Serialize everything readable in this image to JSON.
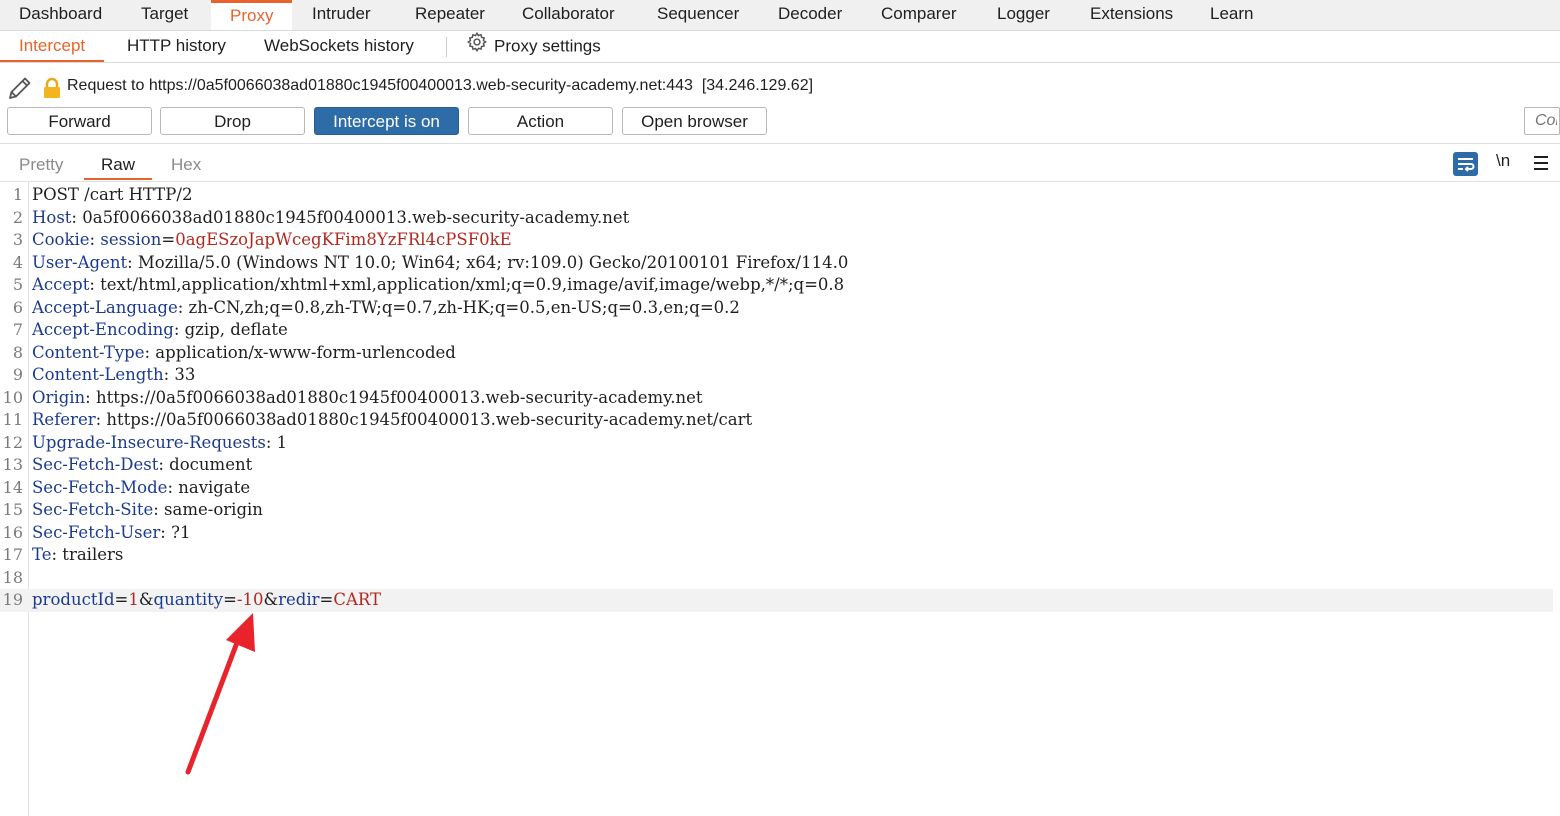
{
  "top_tabs": [
    "Dashboard",
    "Target",
    "Proxy",
    "Intruder",
    "Repeater",
    "Collaborator",
    "Sequencer",
    "Decoder",
    "Comparer",
    "Logger",
    "Extensions",
    "Learn"
  ],
  "active_top_tab": "Proxy",
  "sub_tabs": {
    "intercept": "Intercept",
    "http_history": "HTTP history",
    "websockets_history": "WebSockets history",
    "proxy_settings": "Proxy settings"
  },
  "request": {
    "label": "Request to https://0a5f0066038ad01880c1945f00400013.web-security-academy.net:443",
    "ip": "[34.246.129.62]"
  },
  "buttons": {
    "forward": "Forward",
    "drop": "Drop",
    "intercept": "Intercept is on",
    "action": "Action",
    "open_browser": "Open browser"
  },
  "comment_placeholder": "Comment this item",
  "view_tabs": {
    "pretty": "Pretty",
    "raw": "Raw",
    "hex": "Hex"
  },
  "newline_toggle": "\\n",
  "colors": {
    "accent": "#e8632b",
    "primary_button": "#2d6ca6",
    "header_name": "#1c3b8f",
    "value_red": "#b1281e",
    "arrow": "#e8232b"
  },
  "icons": [
    "pencil-icon",
    "lock-icon",
    "gear-icon",
    "wrap-lines-icon",
    "menu-icon"
  ],
  "raw_lines": {
    "l1": {
      "num": "1",
      "text": "POST /cart HTTP/2"
    },
    "l2": {
      "num": "2",
      "name": "Host",
      "value": " 0a5f0066038ad01880c1945f00400013.web-security-academy.net"
    },
    "l3": {
      "num": "3",
      "name": "Cookie",
      "sep": ": ",
      "cookie_name": "session",
      "eq": "=",
      "cookie_value": "0agESzoJapWcegKFim8YzFRl4cPSF0kE"
    },
    "l4": {
      "num": "4",
      "name": "User-Agent",
      "value": " Mozilla/5.0 (Windows NT 10.0; Win64; x64; rv:109.0) Gecko/20100101 Firefox/114.0"
    },
    "l5": {
      "num": "5",
      "name": "Accept",
      "value": " text/html,application/xhtml+xml,application/xml;q=0.9,image/avif,image/webp,*/*;q=0.8"
    },
    "l6": {
      "num": "6",
      "name": "Accept-Language",
      "value": " zh-CN,zh;q=0.8,zh-TW;q=0.7,zh-HK;q=0.5,en-US;q=0.3,en;q=0.2"
    },
    "l7": {
      "num": "7",
      "name": "Accept-Encoding",
      "value": " gzip, deflate"
    },
    "l8": {
      "num": "8",
      "name": "Content-Type",
      "value": " application/x-www-form-urlencoded"
    },
    "l9": {
      "num": "9",
      "name": "Content-Length",
      "value": " 33"
    },
    "l10": {
      "num": "10",
      "name": "Origin",
      "value": " https://0a5f0066038ad01880c1945f00400013.web-security-academy.net"
    },
    "l11": {
      "num": "11",
      "name": "Referer",
      "value": " https://0a5f0066038ad01880c1945f00400013.web-security-academy.net/cart"
    },
    "l12": {
      "num": "12",
      "name": "Upgrade-Insecure-Requests",
      "value": " 1"
    },
    "l13": {
      "num": "13",
      "name": "Sec-Fetch-Dest",
      "value": " document"
    },
    "l14": {
      "num": "14",
      "name": "Sec-Fetch-Mode",
      "value": " navigate"
    },
    "l15": {
      "num": "15",
      "name": "Sec-Fetch-Site",
      "value": " same-origin"
    },
    "l16": {
      "num": "16",
      "name": "Sec-Fetch-User",
      "value": " ?1"
    },
    "l17": {
      "num": "17",
      "name": "Te",
      "value": " trailers"
    },
    "l18": {
      "num": "18"
    },
    "l19": {
      "num": "19",
      "p1_name": "productId",
      "eq1": "=",
      "p1_value": "1",
      "amp1": "&",
      "p2_name": "quantity",
      "eq2": "=",
      "p2_value": "-10",
      "amp2": "&",
      "p3_name": "redir",
      "eq3": "=",
      "p3_value": "CART"
    }
  }
}
